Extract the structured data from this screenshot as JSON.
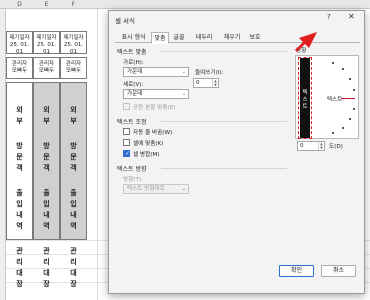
{
  "sheet": {
    "columns": [
      "D",
      "E",
      "F"
    ],
    "cells": [
      {
        "date_label": "제기일자",
        "date_value": "25. 01. 01",
        "manager_line1": "관리자",
        "manager_line2": "모빠두",
        "vertical": [
          "외",
          "부",
          "",
          "방",
          "문",
          "객",
          "",
          "출",
          "입",
          "내",
          "역",
          "",
          "관",
          "리",
          "대",
          "장"
        ]
      },
      {
        "date_label": "제기일자",
        "date_value": "25. 01. 01",
        "manager_line1": "관리자",
        "manager_line2": "모빠두",
        "vertical": [
          "외",
          "부",
          "",
          "방",
          "문",
          "객",
          "",
          "출",
          "입",
          "내",
          "역",
          "",
          "관",
          "리",
          "대",
          "장"
        ]
      },
      {
        "date_label": "제기일자",
        "date_value": "25. 01. 01",
        "manager_line1": "관리자",
        "manager_line2": "모빠두",
        "vertical": [
          "외",
          "부",
          "",
          "방",
          "문",
          "객",
          "",
          "출",
          "입",
          "내",
          "역",
          "",
          "관",
          "리",
          "대",
          "장"
        ]
      }
    ]
  },
  "dialog": {
    "title": "셀 서식",
    "help": "?",
    "close": "✕",
    "tabs": [
      "표시 형식",
      "맞춤",
      "글꼴",
      "테두리",
      "채우기",
      "보호"
    ],
    "active_tab": "맞춤",
    "alignment_section": "텍스트 맞춤",
    "horizontal_label": "가로(H):",
    "horizontal_value": "가운데",
    "indent_label": "들여쓰기(I):",
    "indent_value": "0",
    "vertical_label": "세로(V):",
    "vertical_value": "가운데",
    "distributed_label": "균등 분할 맞춤(E)",
    "control_section": "텍스트 조정",
    "wrap_label": "자동 줄 바꿈(W)",
    "shrink_label": "셀에 맞춤(K)",
    "merge_label": "셀 병합(M)",
    "direction_section": "텍스트 방향",
    "direction_label": "방향(T):",
    "direction_value": "텍스트 방향대로",
    "orientation_title": "방향",
    "orientation_vertical_text": [
      "텍",
      "스",
      "트"
    ],
    "orientation_text_label": "텍스트",
    "degrees_value": "0",
    "degrees_label": "도(D)",
    "ok_label": "확인",
    "cancel_label": "취소"
  },
  "colors": {
    "accent": "#2f6fd1",
    "highlight_red": "#e02020",
    "cell_gray": "#d0d0d0"
  }
}
